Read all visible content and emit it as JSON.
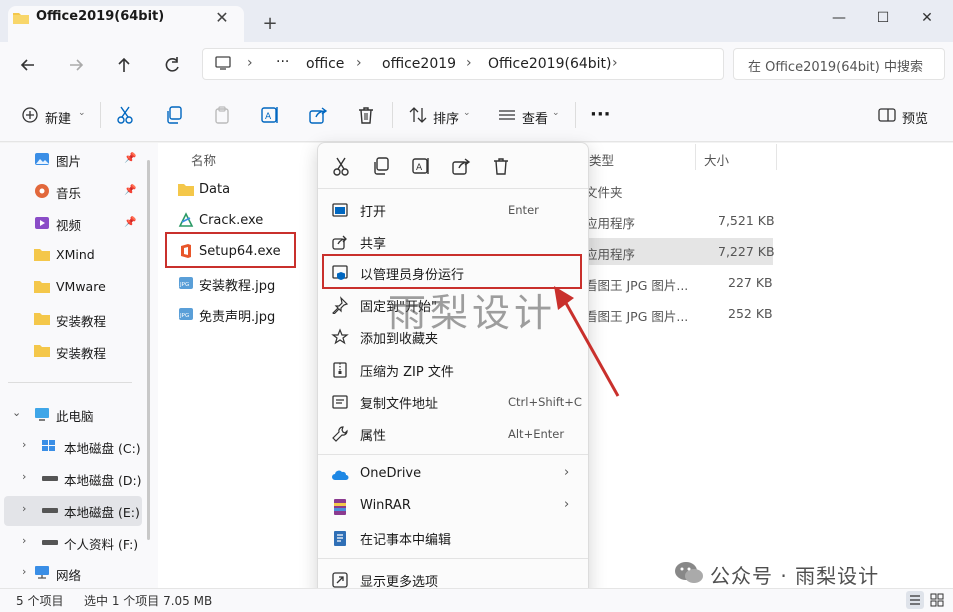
{
  "window": {
    "tab_title": "Office2019(64bit)",
    "tab_close": "✕",
    "new_tab": "+",
    "minimize": "—",
    "maximize": "☐",
    "close": "✕"
  },
  "nav": {
    "breadcrumbs": [
      "office",
      "office2019",
      "Office2019(64bit)"
    ],
    "ellipsis": "···",
    "search_placeholder": "在 Office2019(64bit) 中搜索"
  },
  "commandbar": {
    "new_label": "新建",
    "sort_label": "排序",
    "view_label": "查看",
    "more": "···",
    "preview_label": "预览"
  },
  "sidebar": {
    "quick_items": [
      {
        "label": "图片",
        "icon": "pictures-icon",
        "pinned": true
      },
      {
        "label": "音乐",
        "icon": "music-icon",
        "pinned": true
      },
      {
        "label": "视频",
        "icon": "videos-icon",
        "pinned": true
      },
      {
        "label": "XMind",
        "icon": "folder-icon",
        "pinned": false
      },
      {
        "label": "VMware",
        "icon": "folder-icon",
        "pinned": false
      },
      {
        "label": "安装教程",
        "icon": "folder-icon",
        "pinned": false
      },
      {
        "label": "安装教程",
        "icon": "folder-icon",
        "pinned": false
      }
    ],
    "this_pc": "此电脑",
    "drives": [
      {
        "label": "本地磁盘 (C:)",
        "selected": false
      },
      {
        "label": "本地磁盘 (D:)",
        "selected": false
      },
      {
        "label": "本地磁盘 (E:)",
        "selected": true
      },
      {
        "label": "个人资料 (F:)",
        "selected": false
      }
    ],
    "network": "网络"
  },
  "filelist": {
    "columns": {
      "name": "名称",
      "type": "类型",
      "size": "大小"
    },
    "files": [
      {
        "name": "Data",
        "type": "文件夹",
        "size": "",
        "icon": "folder-icon"
      },
      {
        "name": "Crack.exe",
        "type": "应用程序",
        "size": "7,521 KB",
        "icon": "crack-exe-icon"
      },
      {
        "name": "Setup64.exe",
        "type": "应用程序",
        "size": "7,227 KB",
        "icon": "office-setup-icon"
      },
      {
        "name": "安装教程.jpg",
        "type": "看图王 JPG 图片...",
        "size": "227 KB",
        "icon": "jpg-icon"
      },
      {
        "name": "免责声明.jpg",
        "type": "看图王 JPG 图片...",
        "size": "252 KB",
        "icon": "jpg-icon"
      }
    ]
  },
  "context_menu": {
    "items": [
      {
        "label": "打开",
        "shortcut": "Enter",
        "icon": "open-icon"
      },
      {
        "label": "共享",
        "shortcut": "",
        "icon": "share-icon"
      },
      {
        "label": "以管理员身份运行",
        "shortcut": "",
        "icon": "admin-shield-icon"
      },
      {
        "label": "固定到\"开始\"",
        "shortcut": "",
        "icon": "pin-icon"
      },
      {
        "label": "添加到收藏夹",
        "shortcut": "",
        "icon": "star-icon"
      },
      {
        "label": "压缩为 ZIP 文件",
        "shortcut": "",
        "icon": "zip-icon"
      },
      {
        "label": "复制文件地址",
        "shortcut": "Ctrl+Shift+C",
        "icon": "copy-path-icon"
      },
      {
        "label": "属性",
        "shortcut": "Alt+Enter",
        "icon": "wrench-icon"
      },
      {
        "label": "OneDrive",
        "shortcut": "",
        "icon": "onedrive-icon",
        "submenu": true
      },
      {
        "label": "WinRAR",
        "shortcut": "",
        "icon": "winrar-icon",
        "submenu": true
      },
      {
        "label": "在记事本中编辑",
        "shortcut": "",
        "icon": "notepad-icon"
      },
      {
        "label": "显示更多选项",
        "shortcut": "",
        "icon": "more-options-icon"
      }
    ]
  },
  "statusbar": {
    "count": "5 个项目",
    "selection": "选中 1 个项目  7.05 MB"
  },
  "watermark": {
    "center": "雨梨设计",
    "corner": "公众号 · 雨梨设计"
  },
  "colors": {
    "accent": "#0067c0",
    "highlight_red": "#c9302c",
    "folder": "#f4c74a"
  }
}
